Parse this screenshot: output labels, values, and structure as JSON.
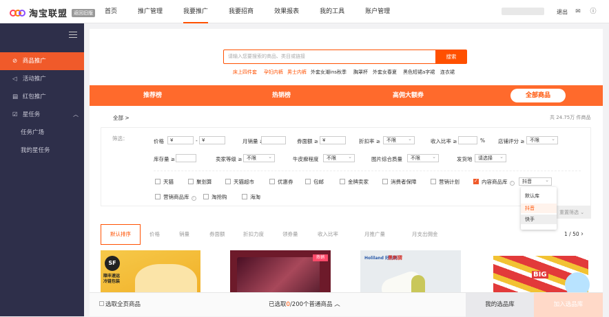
{
  "brand": {
    "name": "淘宝联盟",
    "old_badge": "返回旧版"
  },
  "nav": [
    "首页",
    "推广管理",
    "我要推广",
    "我要招商",
    "效果报表",
    "我的工具",
    "账户管理"
  ],
  "header": {
    "logout": "退出"
  },
  "sidebar": {
    "items": [
      "商品推广",
      "活动推广",
      "红包推广",
      "星任务",
      "任务广场",
      "我的星任务"
    ]
  },
  "search": {
    "placeholder": "请输入您要搜索的商品、类目或链接",
    "button": "搜索"
  },
  "hot_keywords": [
    "床上四件套",
    "孕妇内裤",
    "男士内裤",
    "外套女潮ins秋季",
    "胸罩杯",
    "外套女春夏",
    "黑色短裙a字裙",
    "连衣裙"
  ],
  "tabs": [
    "推荐榜",
    "热销榜",
    "高佣大额券",
    "全部商品"
  ],
  "breadcrumb": "全部",
  "total": "共 24.75万 件商品",
  "filter": {
    "label": "筛选：",
    "price": "价格",
    "currency_a": "¥",
    "dash": "-",
    "currency_b": "¥",
    "monthly_sales": "月销量 ≥",
    "coupon": "券面额 ≥",
    "coupon_currency": "¥",
    "discount": "折扣率 ≥",
    "discount_val": "不限",
    "commission": "收入比率 ≥",
    "percent": "%",
    "shop_score": "店铺评分 ≥",
    "shop_score_val": "不限",
    "stock": "库存量 ≥",
    "seller_level": "卖家等级 ≥",
    "seller_level_val": "不限",
    "psoriasis": "牛皮癣程度",
    "psoriasis_val": "不限",
    "image_quality": "图片综合质量",
    "image_quality_val": "不限",
    "ship_from": "发货地",
    "ship_from_val": "请选择",
    "checkboxes": [
      "天猫",
      "聚划算",
      "天猫超市",
      "优惠券",
      "包邮",
      "金牌卖家",
      "消费者保障",
      "营销计划",
      "内容商品库",
      "营销商品库",
      "淘抢购",
      "海淘"
    ],
    "content_lib_value": "抖音",
    "dropdown": [
      "默认库",
      "抖音",
      "快手"
    ],
    "reset": "重置筛选"
  },
  "sort": [
    "默认排序",
    "价格",
    "销量",
    "券面额",
    "折扣力度",
    "领券量",
    "收入比率",
    "月推广量",
    "月支出佣金"
  ],
  "pager": {
    "text": "1 / 50"
  },
  "products": [
    {
      "badge": "SF",
      "text": "顺丰速运 冷链包装"
    },
    {
      "badge": "热销"
    },
    {
      "brand": "Holiland 好利来",
      "tag": "黑刺猬"
    },
    {
      "text": "BIG"
    }
  ],
  "bottom": {
    "select_all": "选取全页商品",
    "prefix": "已选取",
    "count": "0",
    "suffix": "/200个普通商品",
    "my_lib": "我的选品库",
    "add": "加入选品库"
  },
  "colors": {
    "accent": "#ff5000",
    "sidebar": "#2e2f4a",
    "tabs": "#ff6a2c"
  }
}
